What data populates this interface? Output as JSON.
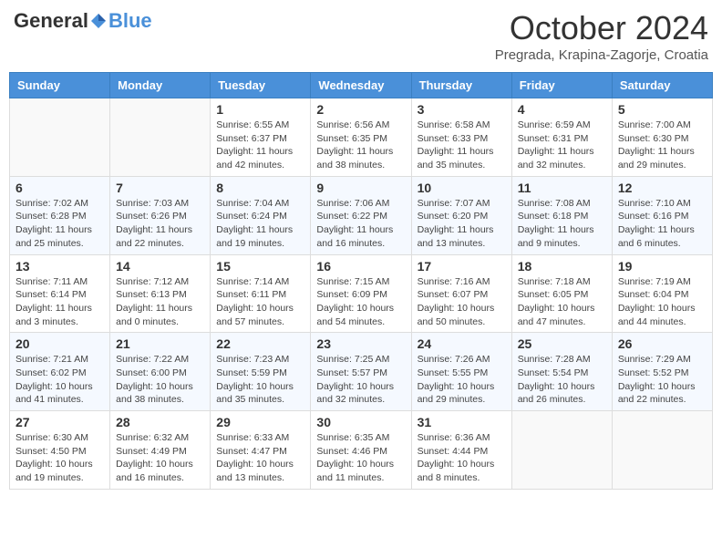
{
  "header": {
    "logo": {
      "general": "General",
      "blue": "Blue"
    },
    "title": "October 2024",
    "subtitle": "Pregrada, Krapina-Zagorje, Croatia"
  },
  "days_of_week": [
    "Sunday",
    "Monday",
    "Tuesday",
    "Wednesday",
    "Thursday",
    "Friday",
    "Saturday"
  ],
  "weeks": [
    [
      {
        "day": "",
        "empty": true
      },
      {
        "day": "",
        "empty": true
      },
      {
        "day": "1",
        "sunrise": "Sunrise: 6:55 AM",
        "sunset": "Sunset: 6:37 PM",
        "daylight": "Daylight: 11 hours and 42 minutes."
      },
      {
        "day": "2",
        "sunrise": "Sunrise: 6:56 AM",
        "sunset": "Sunset: 6:35 PM",
        "daylight": "Daylight: 11 hours and 38 minutes."
      },
      {
        "day": "3",
        "sunrise": "Sunrise: 6:58 AM",
        "sunset": "Sunset: 6:33 PM",
        "daylight": "Daylight: 11 hours and 35 minutes."
      },
      {
        "day": "4",
        "sunrise": "Sunrise: 6:59 AM",
        "sunset": "Sunset: 6:31 PM",
        "daylight": "Daylight: 11 hours and 32 minutes."
      },
      {
        "day": "5",
        "sunrise": "Sunrise: 7:00 AM",
        "sunset": "Sunset: 6:30 PM",
        "daylight": "Daylight: 11 hours and 29 minutes."
      }
    ],
    [
      {
        "day": "6",
        "sunrise": "Sunrise: 7:02 AM",
        "sunset": "Sunset: 6:28 PM",
        "daylight": "Daylight: 11 hours and 25 minutes."
      },
      {
        "day": "7",
        "sunrise": "Sunrise: 7:03 AM",
        "sunset": "Sunset: 6:26 PM",
        "daylight": "Daylight: 11 hours and 22 minutes."
      },
      {
        "day": "8",
        "sunrise": "Sunrise: 7:04 AM",
        "sunset": "Sunset: 6:24 PM",
        "daylight": "Daylight: 11 hours and 19 minutes."
      },
      {
        "day": "9",
        "sunrise": "Sunrise: 7:06 AM",
        "sunset": "Sunset: 6:22 PM",
        "daylight": "Daylight: 11 hours and 16 minutes."
      },
      {
        "day": "10",
        "sunrise": "Sunrise: 7:07 AM",
        "sunset": "Sunset: 6:20 PM",
        "daylight": "Daylight: 11 hours and 13 minutes."
      },
      {
        "day": "11",
        "sunrise": "Sunrise: 7:08 AM",
        "sunset": "Sunset: 6:18 PM",
        "daylight": "Daylight: 11 hours and 9 minutes."
      },
      {
        "day": "12",
        "sunrise": "Sunrise: 7:10 AM",
        "sunset": "Sunset: 6:16 PM",
        "daylight": "Daylight: 11 hours and 6 minutes."
      }
    ],
    [
      {
        "day": "13",
        "sunrise": "Sunrise: 7:11 AM",
        "sunset": "Sunset: 6:14 PM",
        "daylight": "Daylight: 11 hours and 3 minutes."
      },
      {
        "day": "14",
        "sunrise": "Sunrise: 7:12 AM",
        "sunset": "Sunset: 6:13 PM",
        "daylight": "Daylight: 11 hours and 0 minutes."
      },
      {
        "day": "15",
        "sunrise": "Sunrise: 7:14 AM",
        "sunset": "Sunset: 6:11 PM",
        "daylight": "Daylight: 10 hours and 57 minutes."
      },
      {
        "day": "16",
        "sunrise": "Sunrise: 7:15 AM",
        "sunset": "Sunset: 6:09 PM",
        "daylight": "Daylight: 10 hours and 54 minutes."
      },
      {
        "day": "17",
        "sunrise": "Sunrise: 7:16 AM",
        "sunset": "Sunset: 6:07 PM",
        "daylight": "Daylight: 10 hours and 50 minutes."
      },
      {
        "day": "18",
        "sunrise": "Sunrise: 7:18 AM",
        "sunset": "Sunset: 6:05 PM",
        "daylight": "Daylight: 10 hours and 47 minutes."
      },
      {
        "day": "19",
        "sunrise": "Sunrise: 7:19 AM",
        "sunset": "Sunset: 6:04 PM",
        "daylight": "Daylight: 10 hours and 44 minutes."
      }
    ],
    [
      {
        "day": "20",
        "sunrise": "Sunrise: 7:21 AM",
        "sunset": "Sunset: 6:02 PM",
        "daylight": "Daylight: 10 hours and 41 minutes."
      },
      {
        "day": "21",
        "sunrise": "Sunrise: 7:22 AM",
        "sunset": "Sunset: 6:00 PM",
        "daylight": "Daylight: 10 hours and 38 minutes."
      },
      {
        "day": "22",
        "sunrise": "Sunrise: 7:23 AM",
        "sunset": "Sunset: 5:59 PM",
        "daylight": "Daylight: 10 hours and 35 minutes."
      },
      {
        "day": "23",
        "sunrise": "Sunrise: 7:25 AM",
        "sunset": "Sunset: 5:57 PM",
        "daylight": "Daylight: 10 hours and 32 minutes."
      },
      {
        "day": "24",
        "sunrise": "Sunrise: 7:26 AM",
        "sunset": "Sunset: 5:55 PM",
        "daylight": "Daylight: 10 hours and 29 minutes."
      },
      {
        "day": "25",
        "sunrise": "Sunrise: 7:28 AM",
        "sunset": "Sunset: 5:54 PM",
        "daylight": "Daylight: 10 hours and 26 minutes."
      },
      {
        "day": "26",
        "sunrise": "Sunrise: 7:29 AM",
        "sunset": "Sunset: 5:52 PM",
        "daylight": "Daylight: 10 hours and 22 minutes."
      }
    ],
    [
      {
        "day": "27",
        "sunrise": "Sunrise: 6:30 AM",
        "sunset": "Sunset: 4:50 PM",
        "daylight": "Daylight: 10 hours and 19 minutes."
      },
      {
        "day": "28",
        "sunrise": "Sunrise: 6:32 AM",
        "sunset": "Sunset: 4:49 PM",
        "daylight": "Daylight: 10 hours and 16 minutes."
      },
      {
        "day": "29",
        "sunrise": "Sunrise: 6:33 AM",
        "sunset": "Sunset: 4:47 PM",
        "daylight": "Daylight: 10 hours and 13 minutes."
      },
      {
        "day": "30",
        "sunrise": "Sunrise: 6:35 AM",
        "sunset": "Sunset: 4:46 PM",
        "daylight": "Daylight: 10 hours and 11 minutes."
      },
      {
        "day": "31",
        "sunrise": "Sunrise: 6:36 AM",
        "sunset": "Sunset: 4:44 PM",
        "daylight": "Daylight: 10 hours and 8 minutes."
      },
      {
        "day": "",
        "empty": true
      },
      {
        "day": "",
        "empty": true
      }
    ]
  ]
}
